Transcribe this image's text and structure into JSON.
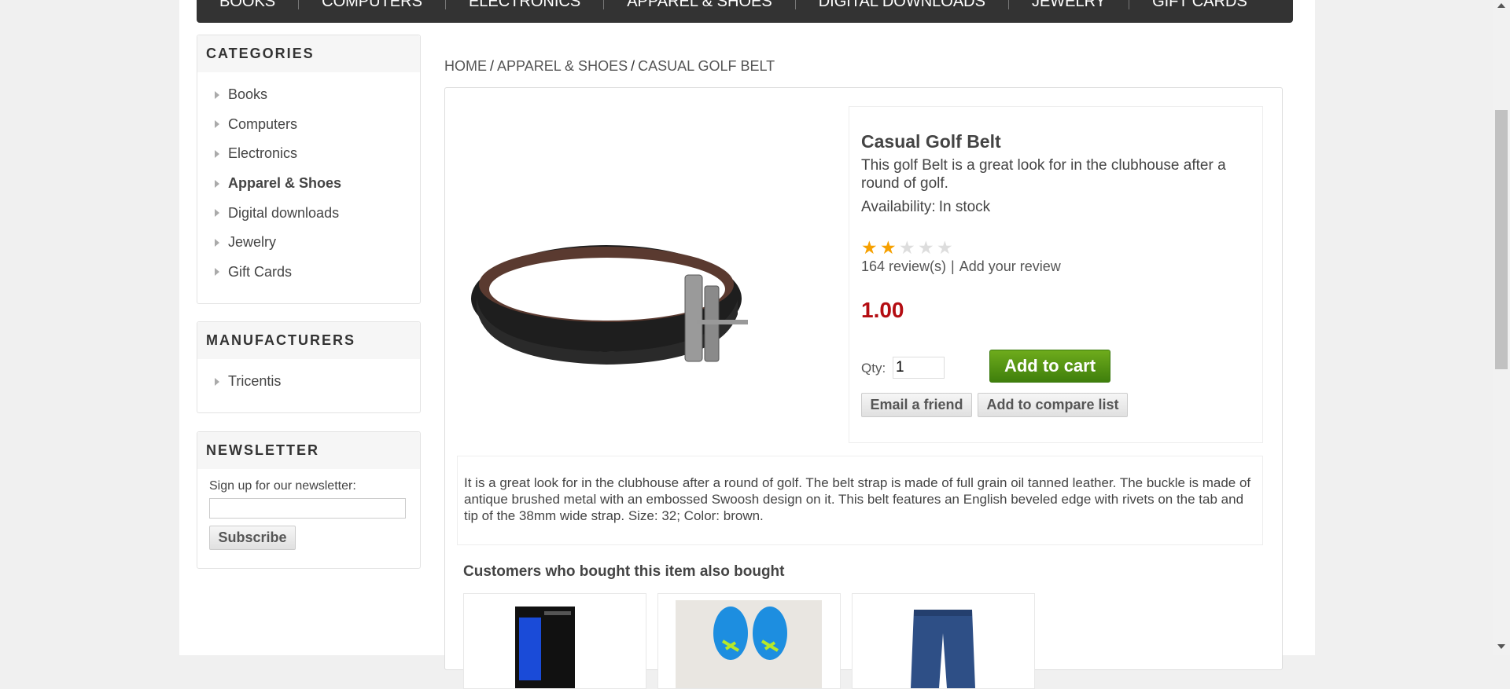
{
  "top_menu": [
    "Books",
    "Computers",
    "Electronics",
    "Apparel & Shoes",
    "Digital downloads",
    "Jewelry",
    "Gift Cards"
  ],
  "categories": {
    "title": "Categories",
    "items": [
      {
        "label": "Books"
      },
      {
        "label": "Computers"
      },
      {
        "label": "Electronics"
      },
      {
        "label": "Apparel & Shoes",
        "active": true
      },
      {
        "label": "Digital downloads"
      },
      {
        "label": "Jewelry"
      },
      {
        "label": "Gift Cards"
      }
    ]
  },
  "manufacturers": {
    "title": "Manufacturers",
    "items": [
      {
        "label": "Tricentis"
      }
    ]
  },
  "newsletter": {
    "title": "Newsletter",
    "label": "Sign up for our newsletter:",
    "input_value": "",
    "button": "Subscribe"
  },
  "breadcrumb": {
    "home": "Home",
    "category": "Apparel & Shoes",
    "current": "Casual Golf Belt",
    "separator": "/"
  },
  "product": {
    "name": "Casual Golf Belt",
    "short_description": "This golf Belt is a great look for in the clubhouse after a round of golf.",
    "availability_label": "Availability:",
    "availability_value": "In stock",
    "rating": {
      "value": 2,
      "max": 5
    },
    "reviews_count": "164 review(s)",
    "review_separator": "|",
    "add_review": "Add your review",
    "price": "1.00",
    "qty_label": "Qty:",
    "qty_value": "1",
    "add_to_cart": "Add to cart",
    "email_friend": "Email a friend",
    "compare": "Add to compare list",
    "full_description": "It is a great look for in the clubhouse after a round of golf. The belt strap is made of full grain oil tanned leather. The buckle is made of antique brushed metal with an embossed Swoosh design on it. This belt features an English beveled edge with rivets on the tab and tip of the 38mm wide strap. Size: 32; Color: brown."
  },
  "also_bought": {
    "title": "Customers who bought this item also bought"
  },
  "colors": {
    "price": "#b40d12",
    "add_to_cart": "#4f8e13",
    "menu_bg": "#333333",
    "star": "#f6a000"
  }
}
